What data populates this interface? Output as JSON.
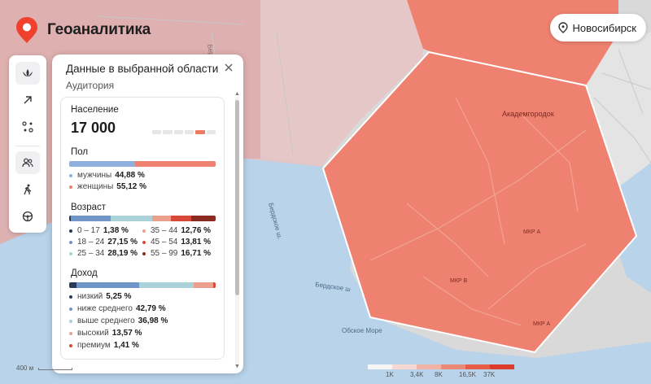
{
  "app": {
    "title": "Геоаналитика",
    "brand_color": "#f0412f"
  },
  "city": {
    "label": "Новосибирск",
    "icon": "location-pin-icon"
  },
  "toolbar": {
    "items": [
      {
        "icon": "lotus-icon",
        "active": true
      },
      {
        "icon": "arrow-up-right-icon",
        "active": false
      },
      {
        "icon": "route-dots-icon",
        "active": false
      },
      {
        "icon": "people-icon",
        "active": true
      },
      {
        "icon": "walking-person-icon",
        "active": false
      },
      {
        "icon": "steering-wheel-icon",
        "active": false
      }
    ]
  },
  "panel": {
    "title": "Данные в выбранной области",
    "section": "Аудитория",
    "population": {
      "label": "Население",
      "value": "17 000",
      "scale_level": 5
    },
    "gender": {
      "label": "Пол",
      "items": [
        {
          "name": "мужчины",
          "value": "44,88 %",
          "color": "#8fb0dc"
        },
        {
          "name": "женщины",
          "value": "55,12 %",
          "color": "#ee8170"
        }
      ]
    },
    "age": {
      "label": "Возраст",
      "items": [
        {
          "name": "0 – 17",
          "value": "1,38 %",
          "color": "#2b3a5a"
        },
        {
          "name": "18 – 24",
          "value": "27,15 %",
          "color": "#6f95c9"
        },
        {
          "name": "25 – 34",
          "value": "28,19 %",
          "color": "#a9d2d9"
        },
        {
          "name": "35 – 44",
          "value": "12,76 %",
          "color": "#eba08e"
        },
        {
          "name": "45 – 54",
          "value": "13,81 %",
          "color": "#d9493a"
        },
        {
          "name": "55 – 99",
          "value": "16,71 %",
          "color": "#8a2a20"
        }
      ]
    },
    "income": {
      "label": "Доход",
      "items": [
        {
          "name": "низкий",
          "value": "5,25 %",
          "color": "#2b3a5a"
        },
        {
          "name": "ниже среднего",
          "value": "42,79 %",
          "color": "#6f95c9"
        },
        {
          "name": "выше среднего",
          "value": "36,98 %",
          "color": "#a9d2d9"
        },
        {
          "name": "высокий",
          "value": "13,57 %",
          "color": "#eba08e"
        },
        {
          "name": "премиум",
          "value": "1,41 %",
          "color": "#d9493a"
        }
      ]
    }
  },
  "map": {
    "labels": {
      "berdsk_road_1": "Бердское ш",
      "berdsk_road_2": "Бердское ш.",
      "berdsk_road_3": "Бердское ш",
      "akademgorodok": "Академгородок",
      "obskoe_more": "Обское Море",
      "mkr_a": "МКР А",
      "mkr_b": "МКР В",
      "mkr_c": "МКР А"
    },
    "distance": "400 м"
  },
  "scale_legend": {
    "labels": [
      "1K",
      "3,4K",
      "8K",
      "16,5K",
      "37K"
    ],
    "colors": [
      "#f6f6f6",
      "#f5d8d2",
      "#f1b3a6",
      "#ec8a78",
      "#e65d48",
      "#dc3d2a"
    ]
  }
}
